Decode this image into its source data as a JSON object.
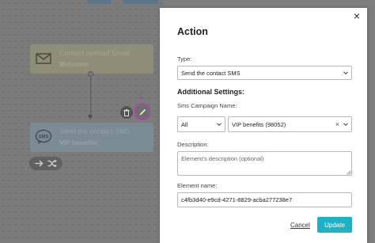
{
  "canvas": {
    "email_node": {
      "title": "Contact opened Email",
      "subtitle": "Welcome"
    },
    "sms_node": {
      "title": "Send the contact SMS",
      "subtitle": "VIP benefits"
    },
    "annotations": {
      "edit_marker": "1",
      "type_marker": "1",
      "campaign_marker": "2"
    }
  },
  "dialog": {
    "title": "Action",
    "close_icon": "×",
    "type_label": "Type:",
    "type_value": "Send the contact SMS",
    "additional_settings_heading": "Additional Settings:",
    "campaign_label": "Sms Campaign Name:",
    "campaign_filter_value": "All",
    "campaign_value": "VIP benefits (98052)",
    "campaign_clear": "×",
    "description_label": "Description:",
    "description_placeholder": "Element's description (optional)",
    "element_name_label": "Element name:",
    "element_name_value": "c4fb3d40-e9cd-4271-8829-acba277238e7",
    "cancel_label": "Cancel",
    "update_label": "Update"
  },
  "colors": {
    "accent": "#1fb1c6",
    "annotation": "#b13cb8"
  }
}
